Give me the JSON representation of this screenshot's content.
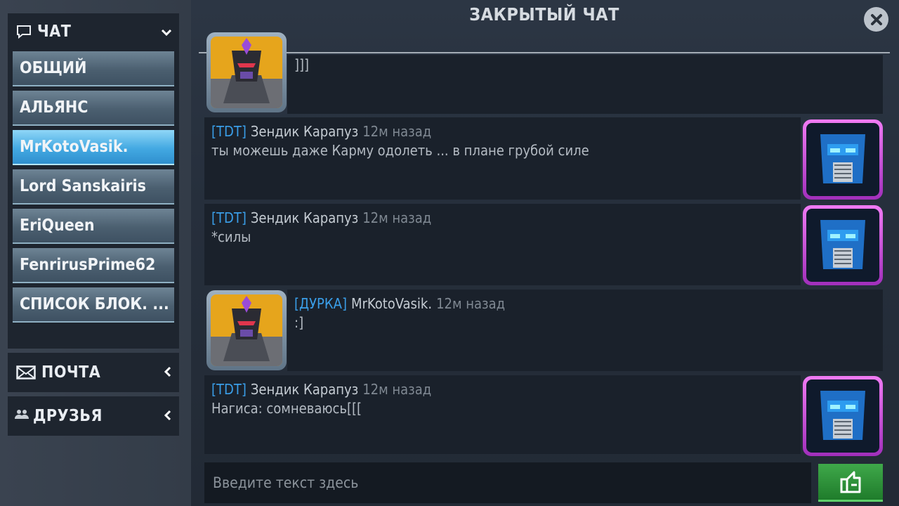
{
  "sidebar": {
    "chat_header": {
      "label": "ЧАТ",
      "icon": "chat-bubble-icon",
      "chevron": "⌄"
    },
    "chat_items": [
      {
        "label": "ОБЩИЙ",
        "active": false
      },
      {
        "label": "АЛЬЯНС",
        "active": false
      },
      {
        "label": "MrKotoVasik.",
        "active": true
      },
      {
        "label": "Lord Sanskairis",
        "active": false
      },
      {
        "label": "EriQueen",
        "active": false
      },
      {
        "label": "FenrirusPrime62",
        "active": false
      },
      {
        "label": "СПИСОК БЛОК. ...",
        "active": false
      }
    ],
    "mail": {
      "label": "ПОЧТА",
      "icon": "envelope-icon",
      "chevron": "‹"
    },
    "friends": {
      "label": "ДРУЗЬЯ",
      "icon": "people-icon",
      "chevron": "‹"
    }
  },
  "header": {
    "title": "ЗАКРЫТЫЙ ЧАТ",
    "close_icon": "close-icon"
  },
  "messages": [
    {
      "side": "left",
      "tag": "",
      "user": "",
      "time": "",
      "text": "]]]",
      "avatar": "gold"
    },
    {
      "side": "right",
      "tag": "[TDT]",
      "user": "Зендик Карапуз",
      "time": "12м назад",
      "text": "ты можешь даже Карму одолеть ... в плане грубой силе",
      "avatar": "purple"
    },
    {
      "side": "right",
      "tag": "[TDT]",
      "user": "Зендик Карапуз",
      "time": "12м назад",
      "text": "*силы",
      "avatar": "purple"
    },
    {
      "side": "left",
      "tag": "[ДУРКА]",
      "user": "MrKotoVasik.",
      "time": "12м назад",
      "text": ":]",
      "avatar": "gold"
    },
    {
      "side": "right",
      "tag": "[TDT]",
      "user": "Зендик Карапуз",
      "time": "12м назад",
      "text": "Нагиса: сомневаюсь[[[",
      "avatar": "purple"
    }
  ],
  "composer": {
    "placeholder": "Введите текст здесь",
    "value": "",
    "send_icon": "send-share-icon"
  },
  "colors": {
    "tag_blue": "#3a9ee8",
    "active_tab": "#43a9e2",
    "send_green": "#2f9a3c",
    "bubble_bg": "#1a212b"
  }
}
